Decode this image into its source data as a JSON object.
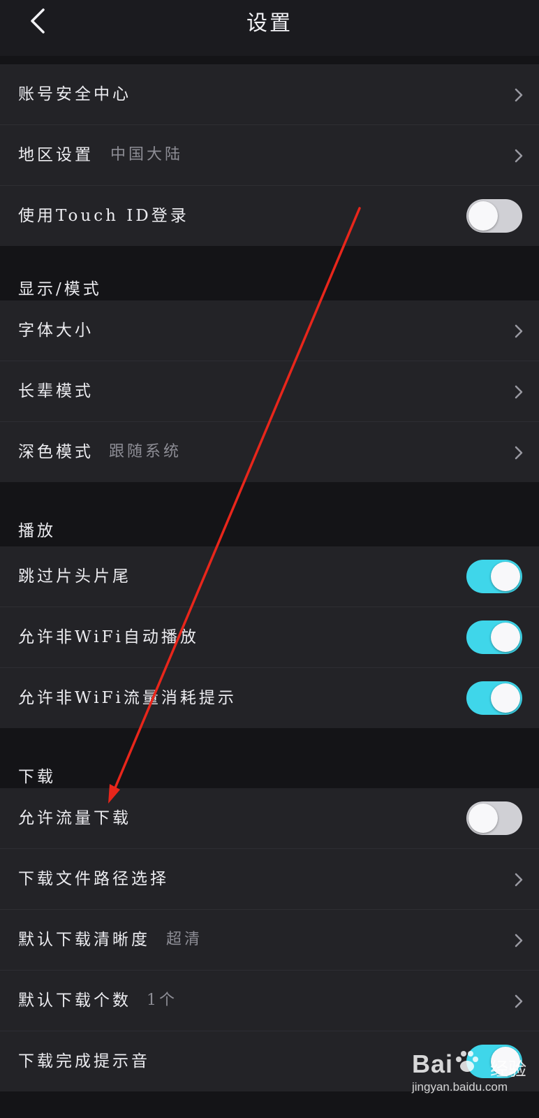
{
  "header": {
    "title": "设置"
  },
  "account": {
    "rows": [
      {
        "label": "账号安全中心",
        "type": "chevron"
      },
      {
        "label": "地区设置",
        "value": "中国大陆",
        "type": "chevron"
      },
      {
        "label": "使用Touch ID登录",
        "type": "toggle",
        "on": false
      }
    ]
  },
  "display": {
    "title": "显示/模式",
    "rows": [
      {
        "label": "字体大小",
        "type": "chevron"
      },
      {
        "label": "长辈模式",
        "type": "chevron"
      },
      {
        "label": "深色模式",
        "value": "跟随系统",
        "type": "chevron"
      }
    ]
  },
  "playback": {
    "title": "播放",
    "rows": [
      {
        "label": "跳过片头片尾",
        "type": "toggle",
        "on": true
      },
      {
        "label": "允许非WiFi自动播放",
        "type": "toggle",
        "on": true
      },
      {
        "label": "允许非WiFi流量消耗提示",
        "type": "toggle",
        "on": true
      }
    ]
  },
  "download": {
    "title": "下载",
    "rows": [
      {
        "label": "允许流量下载",
        "type": "toggle",
        "on": false
      },
      {
        "label": "下载文件路径选择",
        "type": "chevron"
      },
      {
        "label": "默认下载清晰度",
        "value": "超清",
        "type": "chevron"
      },
      {
        "label": "默认下载个数",
        "value": "1个",
        "type": "chevron"
      },
      {
        "label": "下载完成提示音",
        "type": "toggle",
        "on": true
      }
    ]
  },
  "watermark": {
    "brand": "Bai",
    "brand_suffix": "经验",
    "url": "jingyan.baidu.com"
  },
  "colors": {
    "toggle_on": "#3fd6ea",
    "toggle_off": "#d0d0d5",
    "annotation_arrow": "#e8261b"
  }
}
